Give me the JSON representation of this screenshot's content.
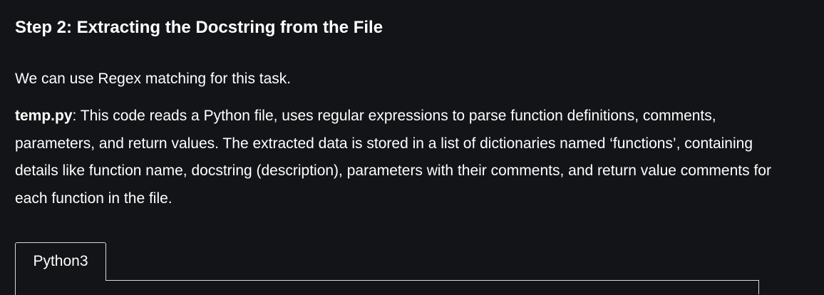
{
  "article": {
    "heading": "Step 2: Extracting the Docstring from the File",
    "intro": "We can use Regex matching for this task.",
    "description": {
      "file_name": "temp.py",
      "text": ": This code reads a Python file, uses regular expressions to parse function definitions, comments, parameters, and return values. The extracted data is stored in a list of dictionaries named ‘functions’, containing details like function name, docstring (description), parameters with their comments, and return value comments for each function in the file."
    }
  },
  "code_block": {
    "tabs": [
      {
        "label": "Python3"
      }
    ]
  }
}
